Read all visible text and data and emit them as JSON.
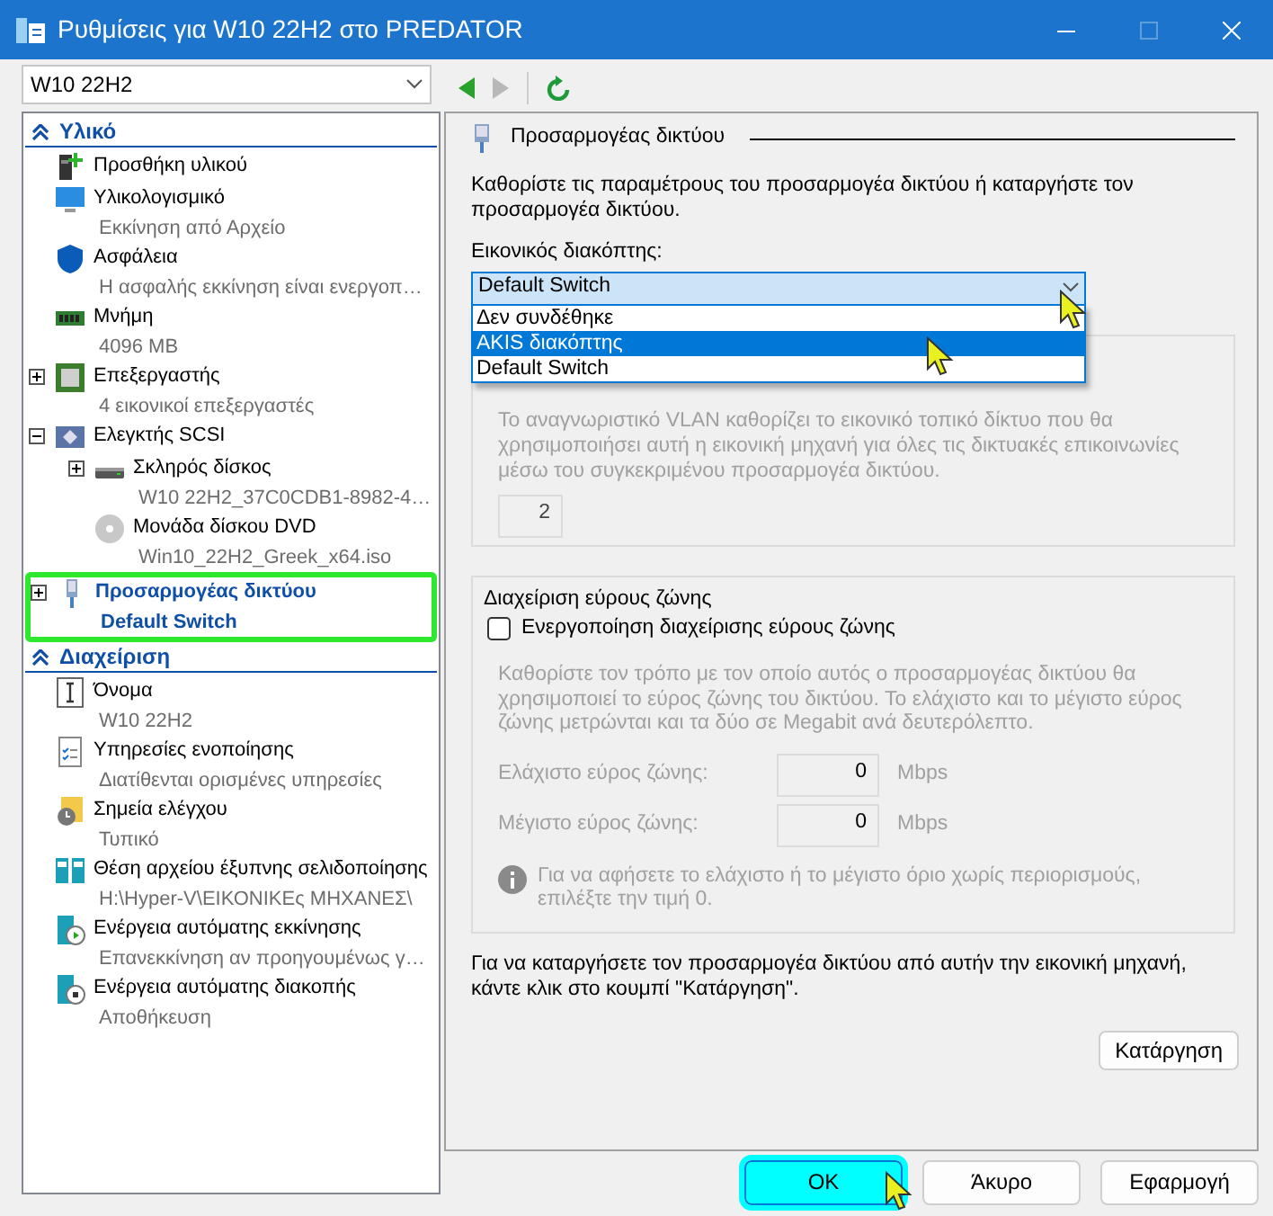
{
  "window": {
    "title": "Ρυθμίσεις για W10 22H2 στο PREDATOR"
  },
  "vm_select": {
    "value": "W10 22H2"
  },
  "nav": {
    "back_enabled": true,
    "forward_enabled": false
  },
  "sidebar": {
    "sections": [
      {
        "title": "Υλικό",
        "items": [
          {
            "title": "Προσθήκη υλικού",
            "kind": "add",
            "selected": false
          },
          {
            "title": "Υλικολογισμικό",
            "subtitle": "Εκκίνηση από Αρχείο",
            "kind": "monitor",
            "selected": false
          },
          {
            "title": "Ασφάλεια",
            "subtitle": "Η ασφαλής εκκίνηση είναι ενεργοπ…",
            "kind": "shield",
            "selected": false
          },
          {
            "title": "Μνήμη",
            "subtitle": "4096 MB",
            "kind": "memory",
            "selected": false
          },
          {
            "title": "Επεξεργαστής",
            "subtitle": "4 εικονικοί επεξεργαστές",
            "kind": "cpu",
            "expanded": false,
            "selected": false
          },
          {
            "title": "Ελεγκτής SCSI",
            "kind": "controller",
            "expanded": true,
            "selected": false,
            "children": [
              {
                "title": "Σκληρός δίσκος",
                "subtitle": "W10 22H2_37C0CDB1-8982-4…",
                "kind": "disk",
                "expanded": false,
                "selected": false
              },
              {
                "title": "Μονάδα δίσκου DVD",
                "subtitle": "Win10_22H2_Greek_x64.iso",
                "kind": "dvd",
                "selected": false
              }
            ]
          },
          {
            "title": "Προσαρμογέας δικτύου",
            "subtitle": "Default Switch",
            "kind": "network",
            "expanded": false,
            "selected": true
          }
        ]
      },
      {
        "title": "Διαχείριση",
        "items": [
          {
            "title": "Όνομα",
            "subtitle": "W10 22H2",
            "kind": "name",
            "selected": false
          },
          {
            "title": "Υπηρεσίες ενοποίησης",
            "subtitle": "Διατίθενται ορισμένες υπηρεσίες",
            "kind": "services",
            "selected": false
          },
          {
            "title": "Σημεία ελέγχου",
            "subtitle": "Τυπικό",
            "kind": "checkpoint",
            "selected": false
          },
          {
            "title": "Θέση αρχείου έξυπνης σελιδοποίησης",
            "subtitle": "H:\\Hyper-V\\ΕΙΚΟΝΙΚΕς ΜΗΧΑΝΕΣ\\",
            "kind": "paging",
            "selected": false
          },
          {
            "title": "Ενέργεια αυτόματης εκκίνησης",
            "subtitle": "Επανεκκίνηση αν προηγουμένως γ…",
            "kind": "autostart",
            "selected": false
          },
          {
            "title": "Ενέργεια αυτόματης διακοπής",
            "subtitle": "Αποθήκευση",
            "kind": "autostop",
            "selected": false
          }
        ]
      }
    ]
  },
  "adapter_panel": {
    "heading": "Προσαρμογέας δικτύου",
    "description": "Καθορίστε τις παραμέτρους του προσαρμογέα δικτύου ή καταργήστε τον προσαρμογέα δικτύου.",
    "switch_label": "Εικονικός διακόπτης:",
    "switch_select": {
      "value": "Default Switch",
      "expanded": true,
      "options": [
        {
          "label": "Δεν συνδέθηκε",
          "highlighted": false
        },
        {
          "label": "AKIS διακόπτης",
          "highlighted": true
        },
        {
          "label": "Default Switch",
          "highlighted": false
        }
      ]
    },
    "vlan": {
      "description": "Το αναγνωριστικό VLAN καθορίζει το εικονικό τοπικό δίκτυο που θα χρησιμοποιήσει αυτή η εικονική μηχανή για όλες τις δικτυακές επικοινωνίες μέσω του συγκεκριμένου προσαρμογέα δικτύου.",
      "value": "2",
      "disabled": true
    },
    "bandwidth": {
      "legend": "Διαχείριση εύρους ζώνης",
      "checkbox_label": "Ενεργοποίηση διαχείρισης εύρους ζώνης",
      "checked": false,
      "description": "Καθορίστε τον τρόπο με τον οποίο αυτός ο προσαρμογέας δικτύου θα χρησιμοποιεί το εύρος ζώνης του δικτύου. Το ελάχιστο και το μέγιστο εύρος ζώνης μετρώνται και τα δύο σε Megabit ανά δευτερόλεπτο.",
      "fields": [
        {
          "label": "Ελάχιστο εύρος ζώνης:",
          "value": "0",
          "unit": "Mbps"
        },
        {
          "label": "Μέγιστο εύρος ζώνης:",
          "value": "0",
          "unit": "Mbps"
        }
      ],
      "info": "Για να αφήσετε το ελάχιστο ή το μέγιστο όριο χωρίς περιορισμούς, επιλέξτε την τιμή 0."
    },
    "remove_text": "Για να καταργήσετε τον προσαρμογέα δικτύου από αυτήν την εικονική μηχανή, κάντε κλικ στο κουμπί \"Κατάργηση\".",
    "remove_button": "Κατάργηση"
  },
  "buttons": [
    {
      "label": "OK",
      "highlighted": true
    },
    {
      "label": "Άκυρο",
      "highlighted": false
    },
    {
      "label": "Εφαρμογή",
      "highlighted": false
    }
  ]
}
